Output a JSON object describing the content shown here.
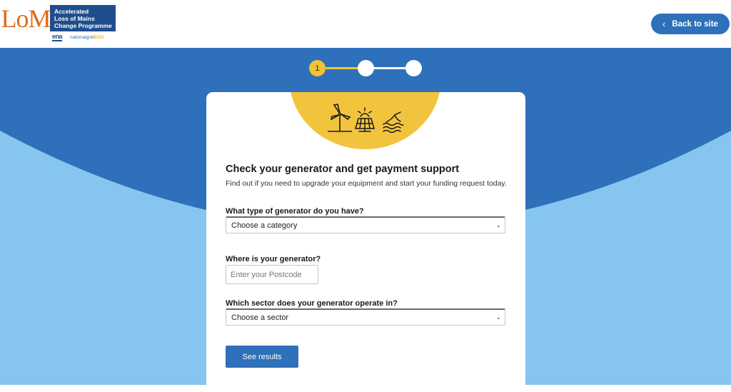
{
  "logo": {
    "mark": "LoM",
    "lines": [
      "Accelerated",
      "Loss of Mains",
      "Change Programme"
    ],
    "partner_1": "ena",
    "partner_2_a": "nationalgrid",
    "partner_2_b": "ESO"
  },
  "header": {
    "back_label": "Back to site",
    "back_icon": "chevron-left-icon"
  },
  "stepper": {
    "current": 1,
    "total": 3,
    "step_labels": [
      "1",
      "",
      ""
    ]
  },
  "colors": {
    "brand_blue": "#2e70b9",
    "dark_blue": "#1f4e8c",
    "sky_blue": "#85c5ef",
    "sun_yellow": "#f2c43e",
    "logo_orange": "#e06a1b"
  },
  "card": {
    "illustration_icons": [
      "wind-turbine-icon",
      "solar-panel-icon",
      "hydro-water-icon"
    ],
    "title": "Check your generator and get payment support",
    "subtitle": "Find out if you need to upgrade your equipment and start your funding request today."
  },
  "form": {
    "generator_type": {
      "label": "What type of generator do you have?",
      "value": "Choose a category"
    },
    "location": {
      "label": "Where is your generator?",
      "placeholder": "Enter your Postcode"
    },
    "sector": {
      "label": "Which sector does your generator operate in?",
      "value": "Choose a sector"
    },
    "submit_label": "See results"
  }
}
